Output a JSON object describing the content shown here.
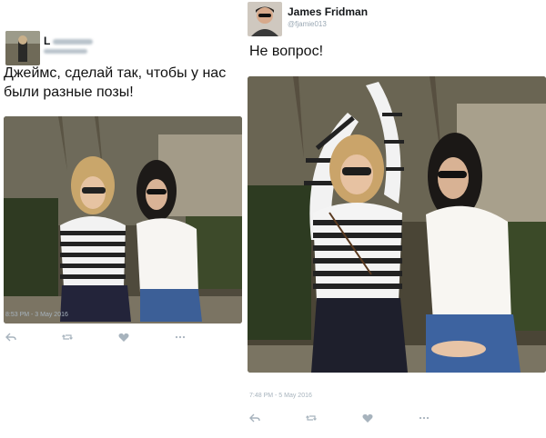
{
  "tweet1": {
    "name": "L",
    "text": "Джеймс, сделай так, чтобы у нас были разные позы!",
    "time": "8:53 PM - 3 May 2016"
  },
  "tweet2": {
    "name": "James Fridman",
    "handle": "@fjamie013",
    "text": "Не вопрос!",
    "time": "7:48 PM - 5 May 2016"
  },
  "icons": [
    "reply-icon",
    "retweet-icon",
    "like-icon",
    "more-icon"
  ],
  "colors": {
    "icon": "#a7b3bd",
    "handle": "#9aa8b4"
  }
}
